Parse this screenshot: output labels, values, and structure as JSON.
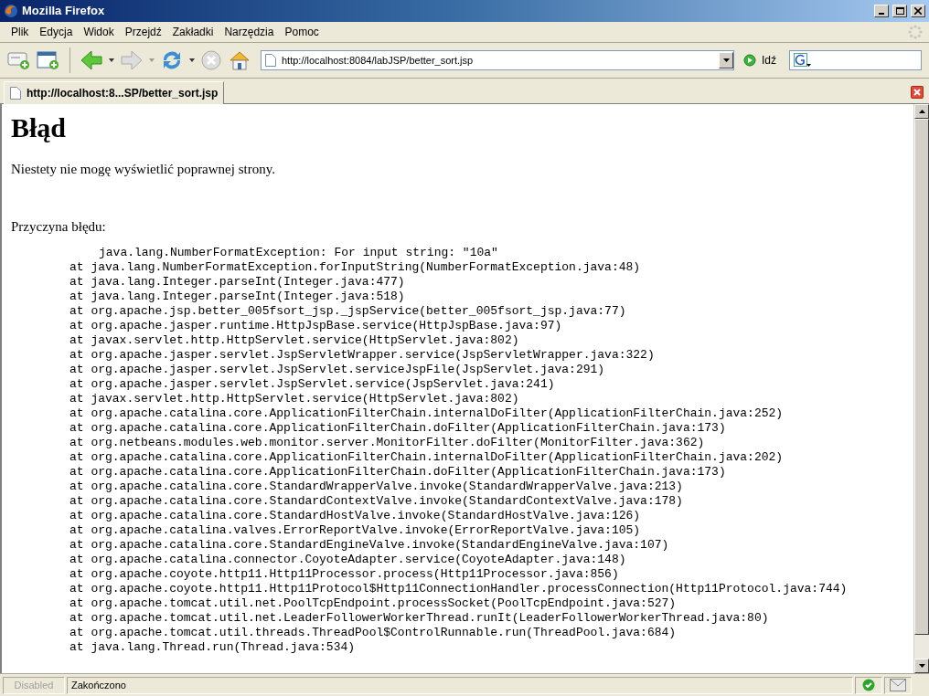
{
  "window": {
    "title": "Mozilla Firefox"
  },
  "menu": [
    "Plik",
    "Edycja",
    "Widok",
    "Przejdź",
    "Zakładki",
    "Narzędzia",
    "Pomoc"
  ],
  "toolbar": {
    "url": "http://localhost:8084/labJSP/better_sort.jsp",
    "go_label": "Idź"
  },
  "tabs": [
    {
      "label": "http://localhost:8...SP/better_sort.jsp",
      "selected": true
    }
  ],
  "page": {
    "heading": "Błąd",
    "message": "Niestety nie mogę wyświetlić poprawnej strony.",
    "cause_label": "Przyczyna błędu:",
    "exception": "java.lang.NumberFormatException: For input string: \"10a\"",
    "trace": [
      "at java.lang.NumberFormatException.forInputString(NumberFormatException.java:48)",
      "at java.lang.Integer.parseInt(Integer.java:477)",
      "at java.lang.Integer.parseInt(Integer.java:518)",
      "at org.apache.jsp.better_005fsort_jsp._jspService(better_005fsort_jsp.java:77)",
      "at org.apache.jasper.runtime.HttpJspBase.service(HttpJspBase.java:97)",
      "at javax.servlet.http.HttpServlet.service(HttpServlet.java:802)",
      "at org.apache.jasper.servlet.JspServletWrapper.service(JspServletWrapper.java:322)",
      "at org.apache.jasper.servlet.JspServlet.serviceJspFile(JspServlet.java:291)",
      "at org.apache.jasper.servlet.JspServlet.service(JspServlet.java:241)",
      "at javax.servlet.http.HttpServlet.service(HttpServlet.java:802)",
      "at org.apache.catalina.core.ApplicationFilterChain.internalDoFilter(ApplicationFilterChain.java:252)",
      "at org.apache.catalina.core.ApplicationFilterChain.doFilter(ApplicationFilterChain.java:173)",
      "at org.netbeans.modules.web.monitor.server.MonitorFilter.doFilter(MonitorFilter.java:362)",
      "at org.apache.catalina.core.ApplicationFilterChain.internalDoFilter(ApplicationFilterChain.java:202)",
      "at org.apache.catalina.core.ApplicationFilterChain.doFilter(ApplicationFilterChain.java:173)",
      "at org.apache.catalina.core.StandardWrapperValve.invoke(StandardWrapperValve.java:213)",
      "at org.apache.catalina.core.StandardContextValve.invoke(StandardContextValve.java:178)",
      "at org.apache.catalina.core.StandardHostValve.invoke(StandardHostValve.java:126)",
      "at org.apache.catalina.valves.ErrorReportValve.invoke(ErrorReportValve.java:105)",
      "at org.apache.catalina.core.StandardEngineValve.invoke(StandardEngineValve.java:107)",
      "at org.apache.catalina.connector.CoyoteAdapter.service(CoyoteAdapter.java:148)",
      "at org.apache.coyote.http11.Http11Processor.process(Http11Processor.java:856)",
      "at org.apache.coyote.http11.Http11Protocol$Http11ConnectionHandler.processConnection(Http11Protocol.java:744)",
      "at org.apache.tomcat.util.net.PoolTcpEndpoint.processSocket(PoolTcpEndpoint.java:527)",
      "at org.apache.tomcat.util.net.LeaderFollowerWorkerThread.runIt(LeaderFollowerWorkerThread.java:80)",
      "at org.apache.tomcat.util.threads.ThreadPool$ControlRunnable.run(ThreadPool.java:684)",
      "at java.lang.Thread.run(Thread.java:534)"
    ]
  },
  "status_bar": {
    "panels": [
      {
        "text": "Disabled",
        "disabled": true
      },
      {
        "text": "Zakończono",
        "disabled": false
      }
    ]
  }
}
